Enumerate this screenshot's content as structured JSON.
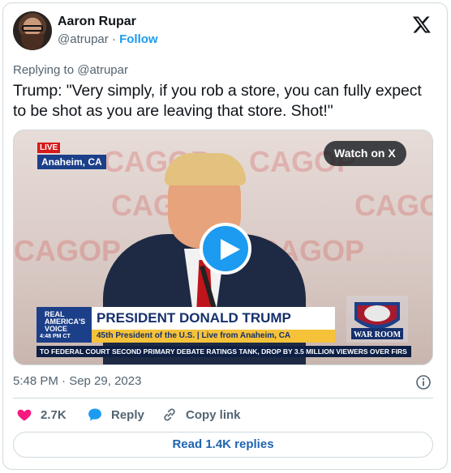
{
  "author": {
    "name": "Aaron Rupar",
    "handle": "@atrupar",
    "separator": "·",
    "follow_label": "Follow"
  },
  "platform_icon": "x-logo-icon",
  "tweet": {
    "reply_to": "Replying to @atrupar",
    "text": "Trump: \"Very simply, if you rob a store, you can fully expect to be shot as you are leaving that store. Shot!\"",
    "timestamp": "5:48 PM · Sep 29, 2023"
  },
  "video": {
    "watch_label": "Watch on X",
    "live_badge": "LIVE",
    "location": "Anaheim, CA",
    "channel_logo": "REAL AMERICA'S VOICE",
    "clock": "4:48 PM CT",
    "headline": "PRESIDENT DONALD TRUMP",
    "subline": "45th President of the U.S. | Live from Anaheim, CA",
    "show_logo": "WAR ROOM",
    "ticker": "TO FEDERAL COURT     SECOND PRIMARY DEBATE RATINGS TANK, DROP BY 3.5 MILLION VIEWERS OVER FIRS",
    "background_text": "CAGOP"
  },
  "actions": {
    "like_count": "2.7K",
    "reply_label": "Reply",
    "copy_label": "Copy link",
    "read_replies": "Read 1.4K replies"
  },
  "colors": {
    "accent": "#1d9bf0",
    "like": "#f91880",
    "text_secondary": "#536471"
  }
}
